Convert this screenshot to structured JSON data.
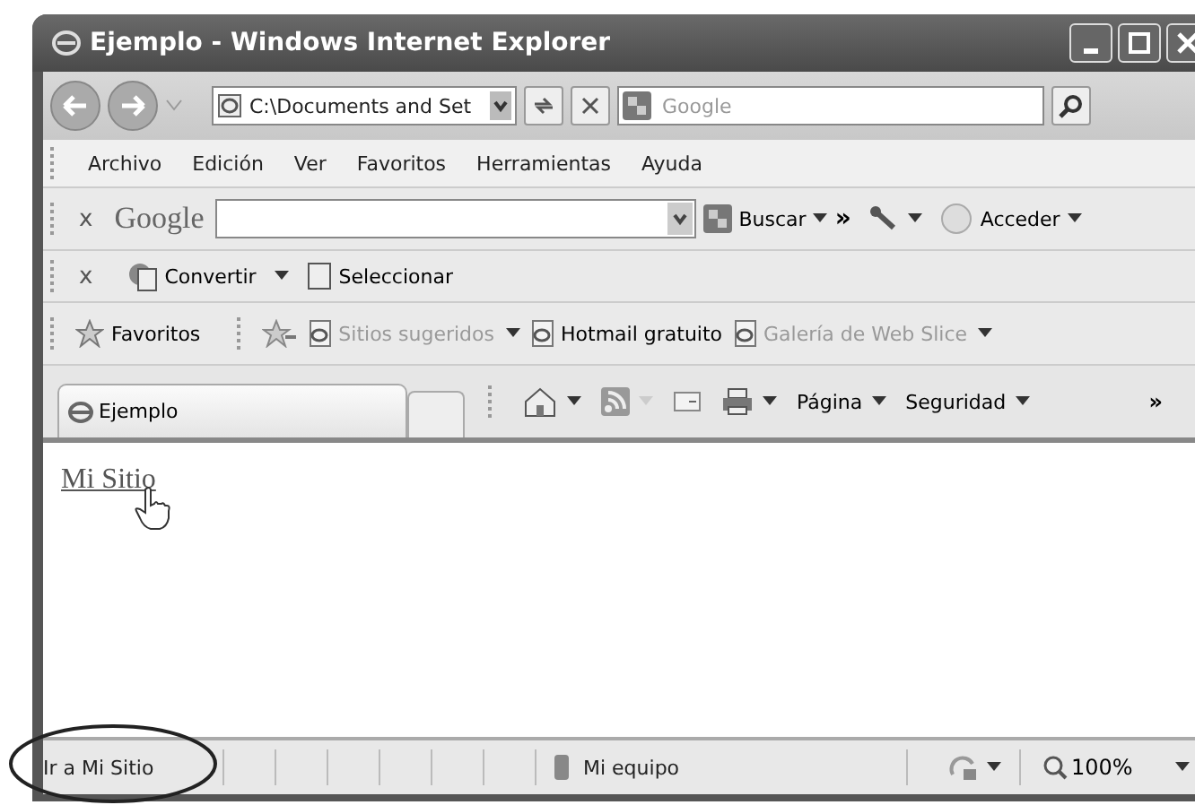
{
  "window": {
    "title": "Ejemplo - Windows Internet Explorer"
  },
  "address": {
    "value": "C:\\Documents and Set"
  },
  "search": {
    "placeholder": "Google"
  },
  "menu": [
    "Archivo",
    "Edición",
    "Ver",
    "Favoritos",
    "Herramientas",
    "Ayuda"
  ],
  "google_toolbar": {
    "close": "x",
    "logo": "Google",
    "search_button": "Buscar",
    "more": "»",
    "signin": "Acceder"
  },
  "convert_toolbar": {
    "close": "x",
    "items": [
      "Convertir",
      "Seleccionar"
    ]
  },
  "favorites_bar": {
    "label": "Favoritos",
    "items": [
      {
        "label": "Sitios sugeridos",
        "disabled": true,
        "dropdown": true
      },
      {
        "label": "Hotmail gratuito",
        "disabled": false,
        "dropdown": false
      },
      {
        "label": "Galería de Web Slice",
        "disabled": true,
        "dropdown": true
      }
    ]
  },
  "tabs": [
    {
      "label": "Ejemplo",
      "selected": true
    }
  ],
  "command_bar": {
    "items": [
      "Página",
      "Seguridad"
    ],
    "more": "»"
  },
  "content": {
    "link": "Mi Sitio"
  },
  "status_bar": {
    "text": "Ir a Mi Sitio",
    "zone": "Mi equipo",
    "zoom": "100%"
  }
}
